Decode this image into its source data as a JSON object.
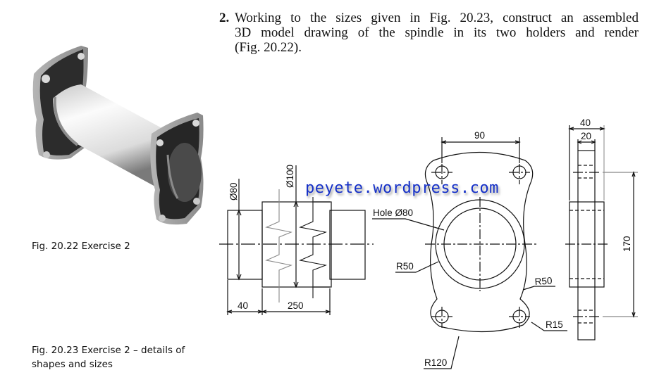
{
  "question": {
    "number": "2.",
    "lines": [
      "Working to the sizes given in Fig. 20.23, construct an assembled",
      "3D model drawing of the spindle in its two holders and render",
      "(Fig. 20.22)."
    ]
  },
  "figures": {
    "render_caption": "Fig. 20.22  Exercise 2",
    "drawing_caption_line1": "Fig. 20.23  Exercise 2 – details of",
    "drawing_caption_line2": "shapes and sizes"
  },
  "watermark": "peyete.wordpress.com",
  "dimensions": {
    "spindle": {
      "diameter_small": "Ø80",
      "diameter_large": "Ø100",
      "length_end": "40",
      "length_middle": "250"
    },
    "holder_front": {
      "hole_spacing": "90",
      "hole_label": "Hole Ø80",
      "radius_left": "R50",
      "radius_right": "R50",
      "radius_corner": "R15",
      "radius_bottom": "R120"
    },
    "holder_side": {
      "overall_width": "40",
      "plate_width": "20",
      "height": "170"
    }
  },
  "colors": {
    "ink": "#111111",
    "watermark": "#1530c8"
  }
}
